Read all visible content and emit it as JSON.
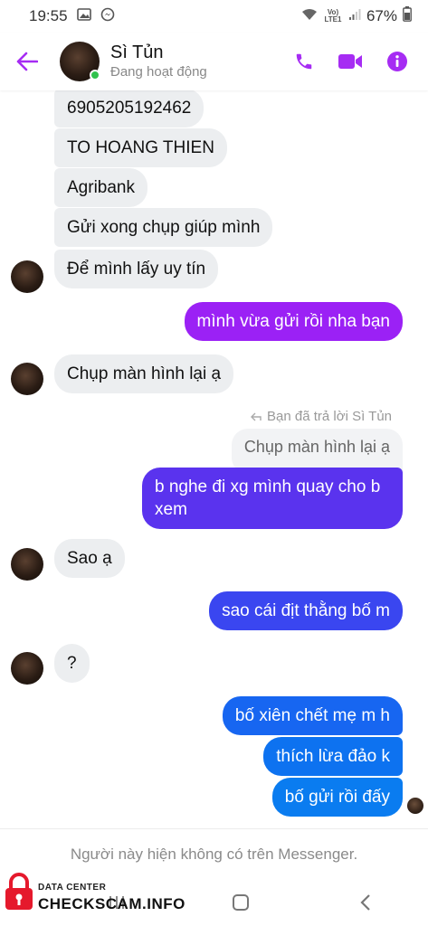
{
  "status_bar": {
    "time": "19:55",
    "volte": "Vo) LTE1",
    "battery": "67%"
  },
  "header": {
    "contact_name": "Sì Tủn",
    "contact_status": "Đang hoạt động",
    "icons": {
      "back": "back-arrow-icon",
      "call": "phone-icon",
      "video": "video-icon",
      "info": "info-icon"
    },
    "accent_color": "#a62cf3"
  },
  "messages": [
    {
      "side": "in",
      "text": "6905205192462"
    },
    {
      "side": "in",
      "text": "TO HOANG THIEN"
    },
    {
      "side": "in",
      "text": "Agribank"
    },
    {
      "side": "in",
      "text": "Gửi xong chụp giúp mình"
    },
    {
      "side": "in",
      "text": "Để mình lấy uy tín"
    },
    {
      "side": "out",
      "text": "mình vừa gửi rồi nha bạn"
    },
    {
      "side": "in",
      "text": "Chụp màn hình lại ạ"
    },
    {
      "side": "out",
      "text": "b nghe đi xg mình quay cho b\nxem"
    },
    {
      "side": "in",
      "text": "Sao ạ"
    },
    {
      "side": "out",
      "text": "sao cái địt thằng bố m"
    },
    {
      "side": "in",
      "text": "?"
    },
    {
      "side": "out",
      "text": "bố xiên chết mẹ m h"
    },
    {
      "side": "out",
      "text": "thích lừa đảo k"
    },
    {
      "side": "out",
      "text": "bố gửi rồi đấy"
    }
  ],
  "reply_context": {
    "label": "Bạn đã trả lời Sì Tủn",
    "quoted_text": "Chụp màn hình lại ạ"
  },
  "footer_note": "Người này hiện không có trên Messenger.",
  "watermark": {
    "small": "DATA CENTER",
    "big": "CHECKSCAM.INFO"
  },
  "colors": {
    "bubble_in": "#eceef0",
    "gradient_purple": "#9b21f5",
    "gradient_indigo": "#5a33ee",
    "gradient_blue": "#0a7cf0"
  }
}
